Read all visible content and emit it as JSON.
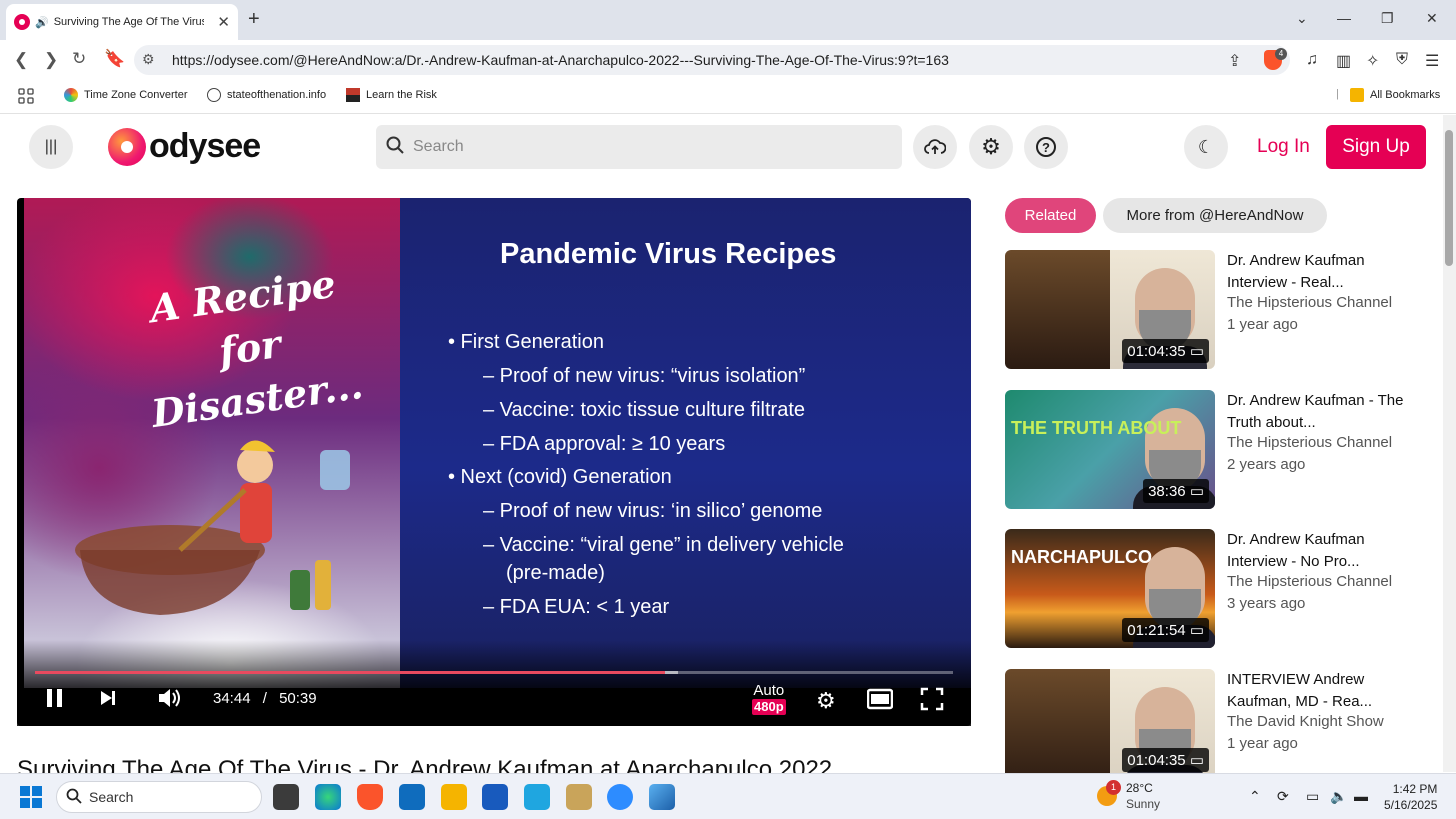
{
  "browser": {
    "tab_title": "Surviving The Age Of The Virus",
    "url": "https://odysee.com/@HereAndNow:a/Dr.-Andrew-Kaufman-at-Anarchapulco-2022---Surviving-The-Age-Of-The-Virus:9?t=163",
    "brave_badge": "4",
    "bookmarks": [
      "Time Zone Converter",
      "stateofthenation.info",
      "Learn the Risk"
    ],
    "all_bookmarks": "All Bookmarks"
  },
  "header": {
    "logo_text": "odysee",
    "search_placeholder": "Search",
    "login_label": "Log In",
    "signup_label": "Sign Up"
  },
  "player": {
    "art_title": "A Recipe for Disaster...",
    "slide_title": "Pandemic Virus Recipes",
    "bullets": [
      "• First Generation",
      "– Proof of new virus: “virus isolation”",
      "– Vaccine: toxic tissue culture filtrate",
      "– FDA approval: ≥ 10 years",
      "• Next (covid) Generation",
      "– Proof of new virus: ‘in silico’ genome",
      "– Vaccine: “viral gene” in delivery vehicle",
      "(pre-made)",
      "– FDA EUA: < 1 year"
    ],
    "current_time": "34:44",
    "separator": "/",
    "duration": "50:39",
    "progress": 0.686,
    "buffered": 0.7,
    "quality_auto": "Auto",
    "quality_res": "480p"
  },
  "video_title": "Surviving The Age Of The Virus - Dr. Andrew Kaufman at Anarchapulco 2022",
  "sidebar": {
    "chips": [
      "Related",
      "More from @HereAndNow"
    ],
    "related": [
      {
        "title": "Dr. Andrew Kaufman Interview - Real...",
        "channel": "The Hipsterious Channel",
        "date": "1 year ago",
        "duration": "01:04:35"
      },
      {
        "title": "Dr. Andrew Kaufman - The Truth about...",
        "channel": "The Hipsterious Channel",
        "date": "2 years ago",
        "duration": "38:36",
        "thumb_text": "THE TRUTH ABOUT"
      },
      {
        "title": "Dr. Andrew Kaufman Interview - No Pro...",
        "channel": "The Hipsterious Channel",
        "date": "3 years ago",
        "duration": "01:21:54",
        "thumb_text": "NARCHAPULCO"
      },
      {
        "title": "INTERVIEW Andrew Kaufman, MD - Rea...",
        "channel": "The David Knight Show",
        "date": "1 year ago",
        "duration": "01:04:35"
      }
    ]
  },
  "taskbar": {
    "search_label": "Search",
    "weather_temp": "28°C",
    "weather_cond": "Sunny",
    "weather_badge": "1",
    "time": "1:42 PM",
    "date": "5/16/2025"
  },
  "colors": {
    "brand": "#e50054",
    "chip_active": "#e0457b",
    "progress": "#e84a5f"
  }
}
